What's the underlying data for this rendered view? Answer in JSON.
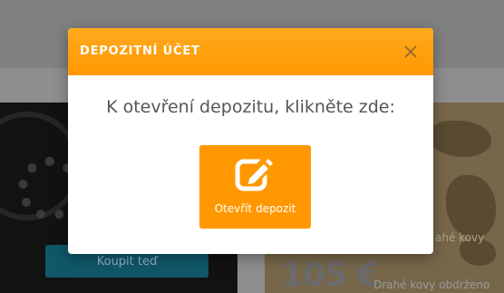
{
  "background": {
    "left_card": {
      "button_label": "Koupit teď"
    },
    "right_card": {
      "price": "105 €",
      "caption_1": "ahé kovy",
      "caption_2": "Drahé kovy obdrženo"
    }
  },
  "modal": {
    "title": "DEPOZITNÍ ÚČET",
    "close_icon": "close-icon",
    "message": "K otevření depozitu, klikněte zde:",
    "button": {
      "icon": "edit-icon",
      "label": "Otevřít depozit"
    }
  },
  "colors": {
    "accent": "#ff9800",
    "header": "#ffa21a",
    "overlay": "#8a8a8a"
  }
}
